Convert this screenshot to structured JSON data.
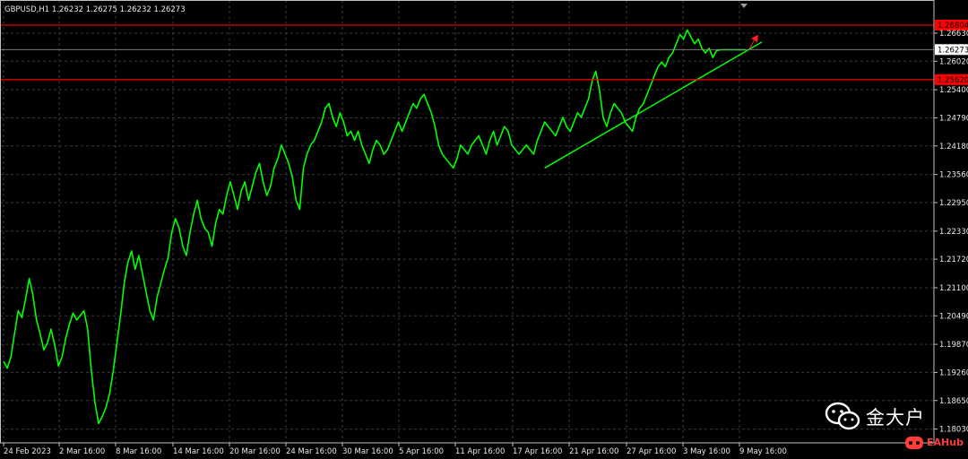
{
  "chart_header": "GBPUSD,H1  1.26232 1.26275 1.26232 1.26273",
  "chart_data": {
    "type": "line",
    "symbol": "GBPUSD",
    "timeframe": "H1",
    "ohlc": {
      "open": "1.26232",
      "high": "1.26275",
      "low": "1.26232",
      "close": "1.26273"
    },
    "ylim": [
      1.1773,
      1.2735
    ],
    "yticks": [
      "1.26630",
      "1.26020",
      "1.25400",
      "1.24790",
      "1.24180",
      "1.23560",
      "1.22950",
      "1.22330",
      "1.21720",
      "1.21100",
      "1.20490",
      "1.19870",
      "1.19260",
      "1.18650",
      "1.18030"
    ],
    "xticks": [
      "24 Feb 2023",
      "2 Mar 16:00",
      "8 Mar 16:00",
      "14 Mar 16:00",
      "20 Mar 16:00",
      "24 Mar 16:00",
      "30 Mar 16:00",
      "5 Apr 16:00",
      "11 Apr 16:00",
      "17 Apr 16:00",
      "21 Apr 16:00",
      "27 Apr 16:00",
      "3 May 16:00",
      "9 May 16:00"
    ],
    "x_positions_note": "",
    "series": [
      {
        "color": "#00ff00",
        "x": [
          0,
          1,
          2,
          3,
          4,
          5,
          6,
          7,
          8,
          9,
          10,
          11,
          12,
          13,
          14,
          15,
          16,
          17,
          18,
          19,
          20,
          21,
          22,
          23,
          24,
          25,
          26,
          27,
          28,
          29,
          30,
          31,
          32,
          33,
          34,
          35,
          36,
          37,
          38,
          39,
          40,
          41,
          42,
          43,
          44,
          45,
          46,
          47,
          48,
          49,
          50,
          51,
          52,
          53,
          54,
          55,
          56,
          57,
          58,
          59,
          60,
          61,
          62,
          63,
          64,
          65,
          66,
          67,
          68,
          69,
          70,
          71,
          72,
          73,
          74,
          75,
          76,
          77,
          78,
          79,
          80,
          81,
          82,
          83,
          84,
          85,
          86,
          87,
          88,
          89,
          90,
          91,
          92,
          93,
          94,
          95,
          96,
          97,
          98,
          99,
          100,
          101,
          102,
          103,
          104,
          105,
          106,
          107,
          108,
          109,
          110,
          111,
          112,
          113,
          114,
          115,
          116,
          117,
          118,
          119,
          120,
          121,
          122,
          123,
          124,
          125,
          126,
          127,
          128,
          129,
          130,
          131,
          132,
          133,
          134,
          135,
          136,
          137,
          138,
          139,
          140,
          141,
          142,
          143,
          144,
          145,
          146,
          147,
          148,
          149,
          150,
          151,
          152,
          153,
          154,
          155,
          156,
          157,
          158,
          159,
          160,
          161,
          162,
          163,
          164,
          165,
          166,
          167,
          168,
          169,
          170,
          171,
          172,
          173,
          174,
          175,
          176,
          177,
          178,
          179,
          180,
          181,
          182,
          183,
          184,
          185,
          186,
          187,
          188,
          189,
          190,
          191,
          192,
          193,
          194,
          195,
          196,
          197,
          198,
          199,
          200,
          201,
          202,
          203,
          204,
          205,
          206,
          207,
          208,
          209,
          210,
          211,
          212,
          213,
          214,
          215,
          216,
          217,
          218,
          219,
          220,
          221,
          222,
          223,
          224,
          225,
          226,
          227,
          228,
          229,
          230,
          231,
          232,
          233,
          234,
          235,
          236,
          237,
          238,
          239,
          240
        ],
        "y": [
          1.195,
          1.1935,
          1.196,
          1.201,
          1.206,
          1.2045,
          1.2085,
          1.213,
          1.2095,
          1.204,
          1.201,
          1.1975,
          1.199,
          1.202,
          1.1985,
          1.194,
          1.196,
          1.2,
          1.203,
          1.2055,
          1.204,
          1.205,
          1.206,
          1.202,
          1.193,
          1.186,
          1.1815,
          1.183,
          1.185,
          1.188,
          1.193,
          1.199,
          1.205,
          1.212,
          1.2165,
          1.219,
          1.215,
          1.218,
          1.214,
          1.21,
          1.206,
          1.204,
          1.209,
          1.212,
          1.215,
          1.2175,
          1.223,
          1.226,
          1.224,
          1.22,
          1.218,
          1.223,
          1.227,
          1.23,
          1.226,
          1.224,
          1.223,
          1.22,
          1.225,
          1.228,
          1.227,
          1.231,
          1.234,
          1.231,
          1.228,
          1.232,
          1.234,
          1.23,
          1.233,
          1.236,
          1.238,
          1.234,
          1.231,
          1.233,
          1.237,
          1.239,
          1.242,
          1.24,
          1.238,
          1.235,
          1.23,
          1.228,
          1.237,
          1.24,
          1.242,
          1.243,
          1.245,
          1.247,
          1.25,
          1.251,
          1.248,
          1.246,
          1.249,
          1.247,
          1.244,
          1.245,
          1.243,
          1.245,
          1.242,
          1.24,
          1.238,
          1.241,
          1.243,
          1.242,
          1.24,
          1.241,
          1.243,
          1.245,
          1.247,
          1.245,
          1.247,
          1.249,
          1.251,
          1.25,
          1.252,
          1.253,
          1.251,
          1.249,
          1.246,
          1.242,
          1.24,
          1.239,
          1.238,
          1.237,
          1.239,
          1.242,
          1.241,
          1.24,
          1.242,
          1.243,
          1.244,
          1.242,
          1.24,
          1.243,
          1.245,
          1.242,
          1.244,
          1.246,
          1.245,
          1.242,
          1.241,
          1.24,
          1.241,
          1.242,
          1.241,
          1.24,
          1.243,
          1.245,
          1.247,
          1.246,
          1.245,
          1.244,
          1.246,
          1.248,
          1.246,
          1.245,
          1.247,
          1.249,
          1.248,
          1.25,
          1.252,
          1.256,
          1.258,
          1.254,
          1.248,
          1.246,
          1.249,
          1.251,
          1.25,
          1.249,
          1.247,
          1.246,
          1.245,
          1.248,
          1.25,
          1.251,
          1.253,
          1.255,
          1.257,
          1.259,
          1.26,
          1.259,
          1.261,
          1.262,
          1.264,
          1.266,
          1.265,
          1.267,
          1.2655,
          1.264,
          1.265,
          1.263,
          1.262,
          1.263,
          1.261,
          1.2625,
          1.2627,
          1.2627,
          1.2627,
          1.2627,
          1.2627,
          1.2627,
          1.2627,
          1.2627,
          1.2627,
          1.2627,
          1.2627,
          1.2627,
          1.2627,
          1.2627,
          1.2627,
          1.2627,
          1.2627,
          1.2627,
          1.2627,
          1.2627,
          1.2627,
          1.2627,
          1.2627,
          1.2627,
          1.2627,
          1.2627,
          1.2627,
          1.2627,
          1.2627,
          1.2627,
          1.2627,
          1.2627,
          1.2627,
          1.2627,
          1.2627,
          1.2627,
          1.2627,
          1.2627,
          1.2627,
          1.2627,
          1.2627,
          1.2627,
          1.2627,
          1.2627,
          1.2627
        ]
      }
    ],
    "hlines": [
      {
        "price": 1.26804,
        "label": "1.26804",
        "color": "#ff0000"
      },
      {
        "price": 1.2562,
        "label": "1.25620",
        "color": "#ff0000"
      }
    ],
    "current_price": {
      "price": 1.26273,
      "label": "1.26273",
      "color": "#c8c8c8"
    },
    "trendline": {
      "x1": 148,
      "y1": 1.237,
      "x2": 203,
      "y2": 1.2636,
      "color": "#00ff00"
    },
    "grid": true,
    "background": "#000000"
  },
  "watermark": {
    "text": "金大户",
    "brand": "EAHub"
  }
}
